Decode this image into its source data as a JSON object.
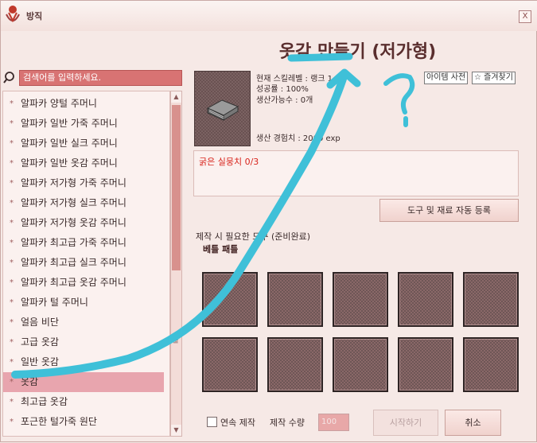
{
  "window": {
    "title": "방직",
    "close_glyph": "X"
  },
  "search": {
    "placeholder": "검색어를 입력하세요."
  },
  "list": {
    "items": [
      "알파카 양털 주머니",
      "알파카 일반 가죽 주머니",
      "알파카 일반 실크 주머니",
      "알파카 일반 옷감 주머니",
      "알파카 저가형 가죽 주머니",
      "알파카 저가형 실크 주머니",
      "알파카 저가형 옷감 주머니",
      "알파카 최고급 가죽 주머니",
      "알파카 최고급 실크 주머니",
      "알파카 최고급 옷감 주머니",
      "알파카 털 주머니",
      "얼음 비단",
      "고급 옷감",
      "일반 옷감",
      "옷감",
      "최고급 옷감",
      "포근한 털가죽 원단"
    ],
    "selected_index": 14,
    "bullet": "*",
    "grip": "≡"
  },
  "detail": {
    "title": "옷감 만들기 (저가형)",
    "skill_level": "현재 스킬레벨 : 랭크 1",
    "success_rate": "성공률 : 100%",
    "craftable": "생산가능수 : 0개",
    "exp": "생산 경험치 : 2000 exp",
    "requirement": "굵은 실뭉치 0/3",
    "item_dictionary_btn": "아이템 사전",
    "favorite_btn": "☆ 즐겨찾기",
    "auto_register_btn": "도구 및 재료 자동 등록",
    "tools_label": "제작 시 필요한 도구 (준비완료)",
    "tool_name": "베틀 패틀"
  },
  "footer": {
    "repeat_label": "연속 제작",
    "qty_label": "제작 수량",
    "qty_value": "100",
    "start_btn": "시작하기",
    "cancel_btn": "취소"
  },
  "colors": {
    "accent": "#d87373",
    "annotation": "#3fc0d8"
  }
}
